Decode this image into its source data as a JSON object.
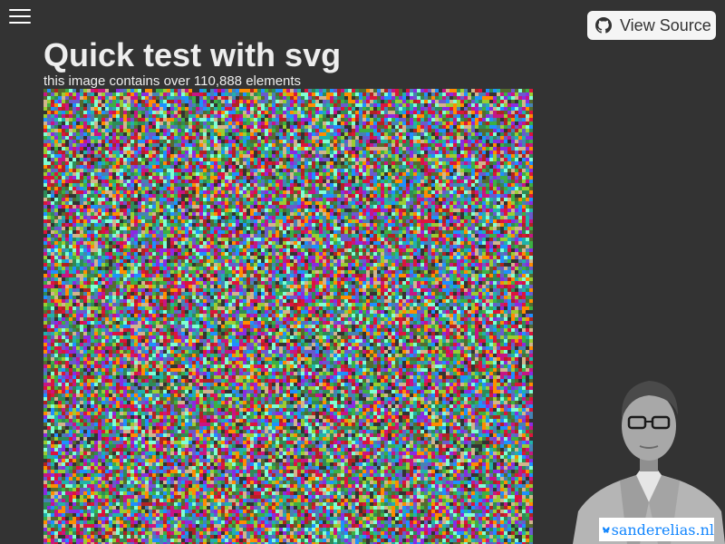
{
  "header": {
    "menu_icon": "hamburger-menu-icon",
    "view_source": {
      "label": "View Source",
      "icon": "github-icon"
    }
  },
  "main": {
    "title": "Quick test with svg",
    "subtitle": "this image contains over 110,888 elements",
    "noise_image": {
      "palette": [
        "#2e8b57",
        "#8a2be2",
        "#3cb043",
        "#c71585",
        "#1e90ff",
        "#9acd32",
        "#ff8c00",
        "#6a5acd",
        "#20b2aa",
        "#dc143c",
        "#556b2f",
        "#4682b4",
        "#d2b48c",
        "#333333",
        "#7fffd4",
        "#b22222"
      ]
    }
  },
  "footer": {
    "portrait": "author-portrait",
    "bluesky_badge": {
      "icon": "bluesky-butterfly-icon",
      "text": "sanderelias.nl",
      "color": "#1185fe"
    }
  }
}
